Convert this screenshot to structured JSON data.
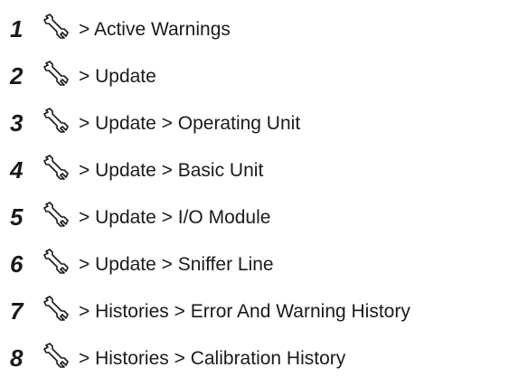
{
  "steps": [
    {
      "number": "1",
      "icon": "wrench-icon",
      "text": "> Active Warnings"
    },
    {
      "number": "2",
      "icon": "wrench-icon",
      "text": "> Update"
    },
    {
      "number": "3",
      "icon": "wrench-icon",
      "text": "> Update > Operating Unit"
    },
    {
      "number": "4",
      "icon": "wrench-icon",
      "text": "> Update > Basic Unit"
    },
    {
      "number": "5",
      "icon": "wrench-icon",
      "text": "> Update > I/O Module"
    },
    {
      "number": "6",
      "icon": "wrench-icon",
      "text": "> Update > Sniffer Line"
    },
    {
      "number": "7",
      "icon": "wrench-icon",
      "text": "> Histories > Error And Warning History"
    },
    {
      "number": "8",
      "icon": "wrench-icon",
      "text": "> Histories > Calibration History"
    }
  ]
}
